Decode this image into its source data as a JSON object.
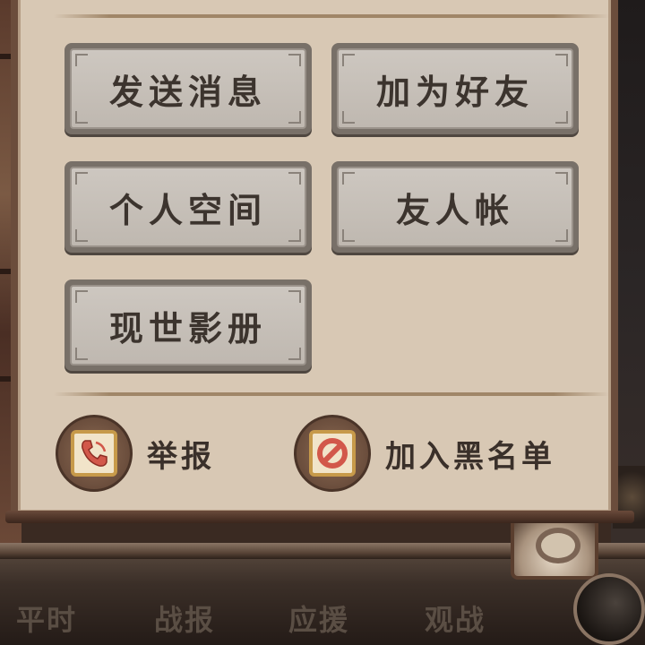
{
  "panel": {
    "buttons": [
      {
        "label": "发送消息"
      },
      {
        "label": "加为好友"
      },
      {
        "label": "个人空间"
      },
      {
        "label": "友人帐"
      },
      {
        "label": "现世影册"
      }
    ],
    "actions": {
      "report_label": "举报",
      "blacklist_label": "加入黑名单"
    }
  },
  "bottom_tabs": [
    {
      "label": "平时"
    },
    {
      "label": "战报"
    },
    {
      "label": "应援"
    },
    {
      "label": "观战"
    }
  ],
  "icons": {
    "report": "phone-icon",
    "blacklist": "prohibit-icon",
    "settings": "gear-icon"
  },
  "colors": {
    "panel_bg": "#d8c8b4",
    "button_face": "#c6c0b8",
    "icon_red": "#d2584a",
    "icon_gold": "#c79a4a"
  }
}
